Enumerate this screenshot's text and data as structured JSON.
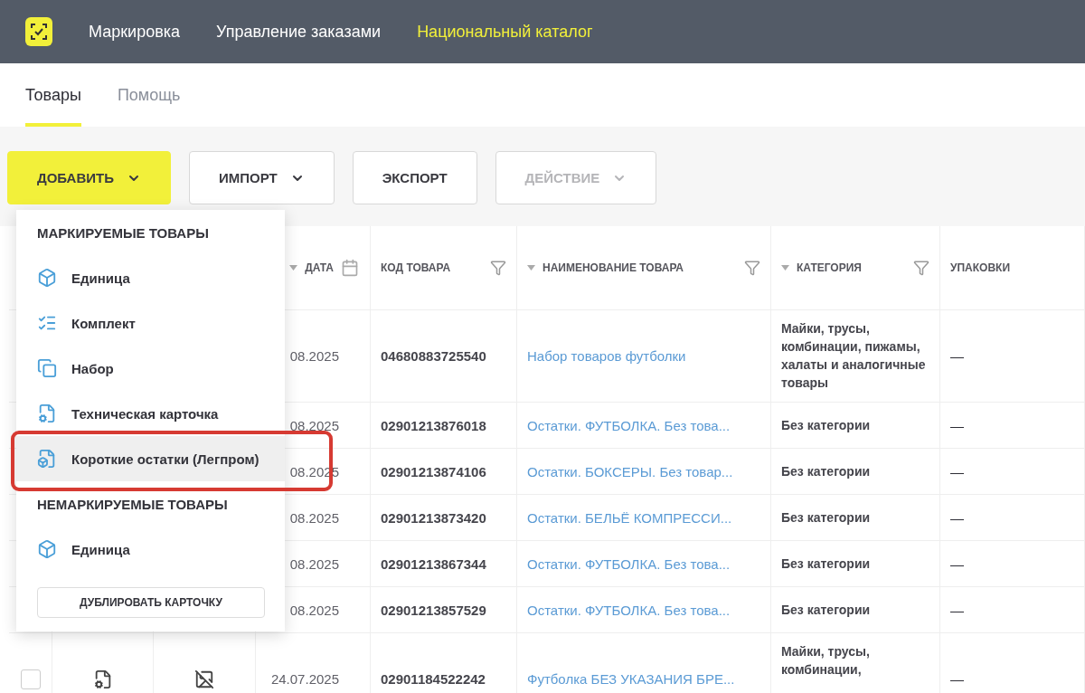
{
  "nav": {
    "items": [
      {
        "label": "Маркировка",
        "selected": false
      },
      {
        "label": "Управление заказами",
        "selected": false
      },
      {
        "label": "Национальный каталог",
        "selected": true
      }
    ]
  },
  "tabs": [
    {
      "label": "Товары",
      "selected": true
    },
    {
      "label": "Помощь",
      "selected": false
    }
  ],
  "toolbar": [
    {
      "label": "ДОБАВИТЬ",
      "kind": "primary",
      "dropdown": true,
      "disabled": false
    },
    {
      "label": "ИМПОРТ",
      "kind": "plain",
      "dropdown": true,
      "disabled": false
    },
    {
      "label": "ЭКСПОРТ",
      "kind": "plain",
      "dropdown": false,
      "disabled": false
    },
    {
      "label": "ДЕЙСТВИЕ",
      "kind": "plain",
      "dropdown": true,
      "disabled": true
    }
  ],
  "table": {
    "columns": [
      {
        "label": "ДАТА",
        "kind": "date",
        "sort": true,
        "filter": false
      },
      {
        "label": "КОД ТОВАРА",
        "kind": "text",
        "sort": false,
        "filter": true
      },
      {
        "label": "НАИМЕНОВАНИЕ ТОВАРА",
        "kind": "text",
        "sort": true,
        "filter": true
      },
      {
        "label": "КАТЕГОРИЯ",
        "kind": "text",
        "sort": true,
        "filter": true
      },
      {
        "label": "УПАКОВКИ",
        "kind": "text",
        "sort": false,
        "filter": false
      }
    ],
    "rows": [
      {
        "date": "08.2025",
        "code": "04680883725540",
        "name": "Набор товаров футболки",
        "category": "Майки, трусы, комбинации, пижамы, халаты и аналогичные товары",
        "packages": "—",
        "tall": true
      },
      {
        "date": "08.2025",
        "code": "02901213876018",
        "name": "Остатки. ФУТБОЛКА. Без това...",
        "category": "Без категории",
        "packages": "—",
        "tall": false
      },
      {
        "date": "08.2025",
        "code": "02901213874106",
        "name": "Остатки. БОКСЕРЫ. Без товар...",
        "category": "Без категории",
        "packages": "—",
        "tall": false
      },
      {
        "date": "08.2025",
        "code": "02901213873420",
        "name": "Остатки. БЕЛЬЁ КОМПРЕССИ...",
        "category": "Без категории",
        "packages": "—",
        "tall": false
      },
      {
        "date": "08.2025",
        "code": "02901213867344",
        "name": "Остатки. ФУТБОЛКА. Без това...",
        "category": "Без категории",
        "packages": "—",
        "tall": false
      },
      {
        "date": "08.2025",
        "code": "02901213857529",
        "name": "Остатки. ФУТБОЛКА. Без това...",
        "category": "Без категории",
        "packages": "—",
        "tall": false
      },
      {
        "date": "24.07.2025",
        "code": "02901184522242",
        "name": "Футболка БЕЗ УКАЗАНИЯ БРЕ...",
        "category": "Майки, трусы, комбинации,",
        "packages": "—",
        "tall": true,
        "checked": false,
        "photo": false
      }
    ]
  },
  "dropdown": {
    "sections": [
      {
        "title": "МАРКИРУЕМЫЕ ТОВАРЫ",
        "items": [
          {
            "label": "Единица",
            "kind": "unit",
            "highlighted": false
          },
          {
            "label": "Комплект",
            "kind": "kit",
            "highlighted": false
          },
          {
            "label": "Набор",
            "kind": "set",
            "highlighted": false
          },
          {
            "label": "Техническая карточка",
            "kind": "tech",
            "highlighted": false
          },
          {
            "label": "Короткие остатки (Легпром)",
            "kind": "remnants",
            "highlighted": true
          }
        ]
      },
      {
        "title": "НЕМАРКИРУЕМЫЕ ТОВАРЫ",
        "items": [
          {
            "label": "Единица",
            "kind": "unit",
            "highlighted": false
          }
        ]
      }
    ],
    "button": "ДУБЛИРОВАТЬ КАРТОЧКУ"
  }
}
